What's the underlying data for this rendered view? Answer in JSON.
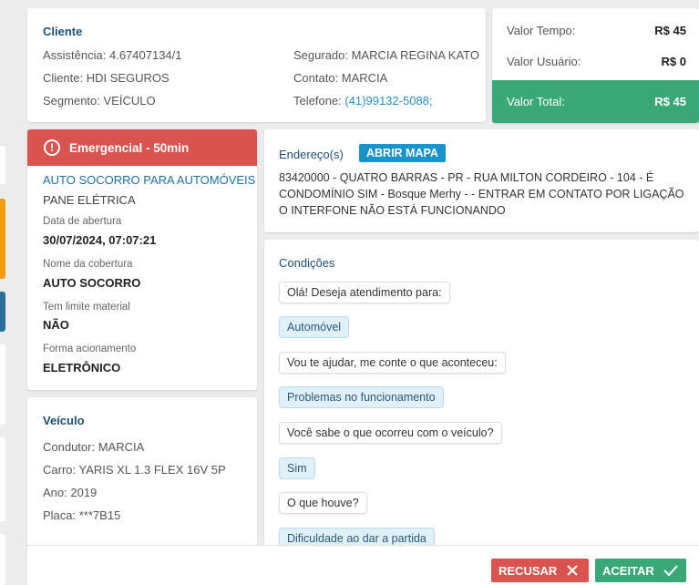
{
  "cliente": {
    "title": "Cliente",
    "assistencia": "Assistência: 4.67407134/1",
    "cliente": "Cliente: HDI SEGUROS",
    "segmento": "Segmento: VEÍCULO",
    "segurado": "Segurado: MARCIA REGINA KATO",
    "contato": "Contato: MARCIA",
    "telefone_label": "Telefone: ",
    "telefone": "(41)99132-5088;"
  },
  "valores": {
    "tempo_label": "Valor Tempo:",
    "tempo": "R$ 45",
    "usuario_label": "Valor Usuário:",
    "usuario": "R$ 0",
    "total_label": "Valor Total:",
    "total": "R$ 45"
  },
  "servico": {
    "alert": "Emergencial - 50min",
    "tipo": "AUTO SOCORRO PARA AUTOMÓVEIS",
    "problema": "PANE ELÉTRICA",
    "abertura_label": "Data de abertura",
    "abertura": "30/07/2024, 07:07:21",
    "cobertura_label": "Nome da cobertura",
    "cobertura": "AUTO SOCORRO",
    "limite_label": "Tem limite material",
    "limite": "NÃO",
    "forma_label": "Forma acionamento",
    "forma": "ELETRÔNICO"
  },
  "endereco": {
    "title": "Endereço(s)",
    "map_button": "ABRIR MAPA",
    "text": "83420000 - QUATRO BARRAS - PR - RUA MILTON CORDEIRO - 104 - É CONDOMÍNIO SIM - Bosque Merhy - - ENTRAR EM CONTATO POR LIGAÇÃO O INTERFONE NÃO ESTÁ FUNCIONANDO"
  },
  "condicoes": {
    "title": "Condições",
    "messages": [
      {
        "type": "q",
        "text": "Olá! Deseja atendimento para:"
      },
      {
        "type": "a",
        "text": "Automóvel"
      },
      {
        "type": "q",
        "text": "Vou te ajudar, me conte o que aconteceu:"
      },
      {
        "type": "a",
        "text": "Problemas no funcionamento"
      },
      {
        "type": "q",
        "text": "Você sabe o que ocorreu com o veículo?"
      },
      {
        "type": "a",
        "text": "Sim"
      },
      {
        "type": "q",
        "text": "O que houve?"
      },
      {
        "type": "a",
        "text": "Dificuldade ao dar a partida"
      }
    ]
  },
  "veiculo": {
    "title": "Veículo",
    "condutor": "Condutor: MARCIA",
    "carro": "Carro: YARIS XL 1.3 FLEX 16V 5P",
    "ano": "Ano: 2019",
    "placa": "Placa: ***7B15"
  },
  "actions": {
    "recusar": "RECUSAR",
    "aceitar": "ACEITAR"
  },
  "colors": {
    "danger": "#d9534f",
    "success": "#3aa876",
    "primary": "#1a93c9",
    "heading": "#1f4e79"
  }
}
